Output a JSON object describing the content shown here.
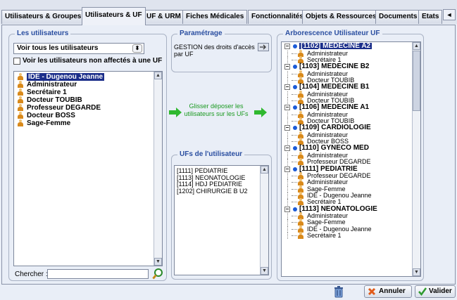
{
  "tabs": [
    {
      "label": "Utilisateurs & Groupes",
      "active": false
    },
    {
      "label": "Utilisateurs & UF",
      "active": true
    },
    {
      "label": "UF & URM",
      "active": false
    },
    {
      "label": "Fiches Médicales",
      "active": false
    },
    {
      "label": "Fonctionnalités",
      "active": false
    },
    {
      "label": "Objets & Ressources",
      "active": false
    },
    {
      "label": "Documents",
      "active": false
    },
    {
      "label": "Etats",
      "active": false
    }
  ],
  "tab_scroll_left": "◄",
  "users_panel": {
    "title": "Les utilisateurs",
    "filter_select": "Voir tous les utilisateurs",
    "filter_arrow": "⬍",
    "checkbox_label": "Voir les utilisateurs non affectés à une UF",
    "checkbox_checked": false,
    "users": [
      {
        "name": "IDE - Dugenou Jeanne",
        "selected": true
      },
      {
        "name": "Administrateur",
        "selected": false
      },
      {
        "name": "Secrétaire 1",
        "selected": false
      },
      {
        "name": "Docteur TOUBIB",
        "selected": false
      },
      {
        "name": "Professeur DEGARDE",
        "selected": false
      },
      {
        "name": "Docteur BOSS",
        "selected": false
      },
      {
        "name": "Sage-Femme",
        "selected": false
      }
    ],
    "search_label": "Chercher :",
    "search_value": ""
  },
  "settings_panel": {
    "title": "Paramétrage",
    "text": "GESTION des droits d'accès par UF",
    "drag_hint": "Glisser déposer les utilisateurs sur les UFs"
  },
  "uf_panel": {
    "title": "UFs de l'utilisateur",
    "items": [
      "[1111] PEDIATRIE",
      "[1113] NEONATOLOGIE",
      "[1114] HDJ PEDIATRIE",
      "[1202] CHIRURGIE B U2"
    ]
  },
  "tree_panel": {
    "title": "Arborescence Utilisateur UF",
    "nodes": [
      {
        "label": "[1102] MEDECINE A2",
        "selected": true,
        "children": [
          "Administrateur",
          "Secrétaire 1"
        ]
      },
      {
        "label": "[1103] MEDECINE B2",
        "selected": false,
        "children": [
          "Administrateur",
          "Docteur TOUBIB"
        ]
      },
      {
        "label": "[1104] MEDECINE B1",
        "selected": false,
        "children": [
          "Administrateur",
          "Docteur TOUBIB"
        ]
      },
      {
        "label": "[1106] MEDECINE A1",
        "selected": false,
        "children": [
          "Administrateur",
          "Docteur TOUBIB"
        ]
      },
      {
        "label": "[1109] CARDIOLOGIE",
        "selected": false,
        "children": [
          "Administrateur",
          "Docteur BOSS"
        ]
      },
      {
        "label": "[1110] GYNECO MED",
        "selected": false,
        "children": [
          "Administrateur",
          "Professeur DEGARDE"
        ]
      },
      {
        "label": "[1111] PEDIATRIE",
        "selected": false,
        "children": [
          "Professeur DEGARDE",
          "Administrateur",
          "Sage-Femme",
          "IDE - Dugenou Jeanne",
          "Secrétaire 1"
        ]
      },
      {
        "label": "[1113] NEONATOLOGIE",
        "selected": false,
        "children": [
          "Administrateur",
          "Sage-Femme",
          "IDE - Dugenou Jeanne",
          "Secrétaire 1"
        ]
      }
    ],
    "expander_symbol": "−"
  },
  "footer": {
    "cancel_label": "Annuler",
    "validate_label": "Valider"
  },
  "colors": {
    "group_title": "#2a4ea0",
    "selection": "#1b2e8a",
    "arrow_green": "#2fb82f",
    "cancel_icon": "#e05a1a",
    "validate_icon": "#2f9a2f"
  }
}
